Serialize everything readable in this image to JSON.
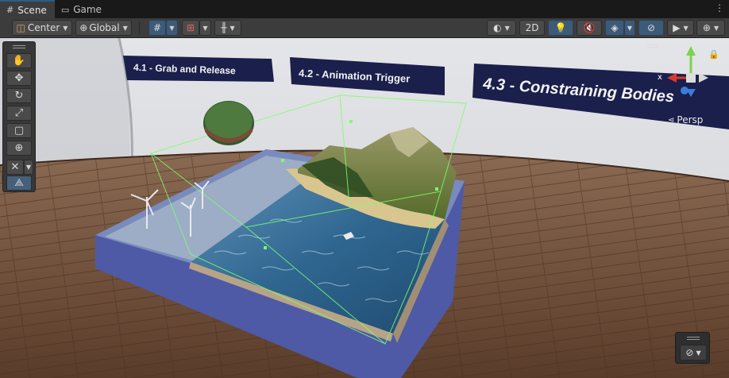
{
  "tabs": [
    {
      "label": "Scene",
      "icon": "scene-grid-icon",
      "active": true
    },
    {
      "label": "Game",
      "icon": "gamepad-icon",
      "active": false
    }
  ],
  "tab_menu_icon": "kebab-menu-icon",
  "toolbar": {
    "pivot_mode": "Center",
    "pivot_rotation": "Global",
    "view_2d": "2D",
    "icons": [
      "grid-snap-icon",
      "increment-snap-icon",
      "ruler-snap-icon",
      "draw-mode-icon",
      "lighting-icon",
      "audio-mute-icon",
      "effects-icon",
      "scene-visibility-icon",
      "camera-icon",
      "gizmos-icon"
    ]
  },
  "scene": {
    "signs": [
      "4.1 - Grab and Release",
      "4.2 - Animation Trigger",
      "4.3 - Constraining Bodies"
    ],
    "projection": "Persp",
    "gizmo_axes": [
      "x",
      "y",
      "z"
    ]
  },
  "tools_palette": [
    "hand-tool-icon",
    "move-tool-icon",
    "rotate-tool-icon",
    "scale-tool-icon",
    "rect-tool-icon",
    "transform-tool-icon",
    "custom-tool-icon",
    "probuilder-tool-icon"
  ],
  "overlay_menu_icon": "orientation-overlay-icon",
  "colors": {
    "accent": "#3d5a78",
    "sign_bg": "#1a1e4a",
    "floor": "#6b4a33",
    "wall": "#e9e9ec",
    "water": "#2d5f86",
    "selection": "#7cff6e"
  }
}
